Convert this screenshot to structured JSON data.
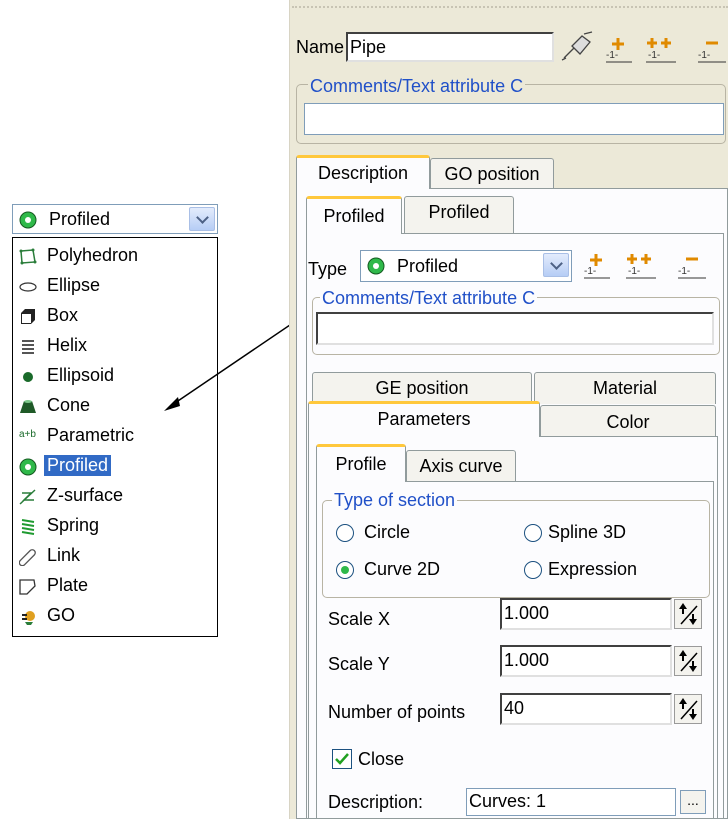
{
  "dropdown": {
    "selected": "Profiled",
    "items": [
      {
        "label": "Polyhedron",
        "icon": "polyhedron-icon"
      },
      {
        "label": "Ellipse",
        "icon": "ellipse-icon"
      },
      {
        "label": "Box",
        "icon": "box-icon"
      },
      {
        "label": "Helix",
        "icon": "helix-icon"
      },
      {
        "label": "Ellipsoid",
        "icon": "ellipsoid-icon"
      },
      {
        "label": "Cone",
        "icon": "cone-icon"
      },
      {
        "label": "Parametric",
        "icon": "parametric-icon",
        "glyph": "a+b"
      },
      {
        "label": "Profiled",
        "icon": "profiled-icon",
        "selected": true
      },
      {
        "label": "Z-surface",
        "icon": "z-surface-icon"
      },
      {
        "label": "Spring",
        "icon": "spring-icon"
      },
      {
        "label": "Link",
        "icon": "link-icon"
      },
      {
        "label": "Plate",
        "icon": "plate-icon"
      },
      {
        "label": "GO",
        "icon": "go-icon"
      }
    ]
  },
  "panel": {
    "name_label": "Name",
    "name_value": "Pipe",
    "comments_label": "Comments/Text attribute C",
    "comments_value": "",
    "tabs": [
      "Description",
      "GO position"
    ],
    "subtabs": [
      "Profiled",
      "Profiled"
    ],
    "type_label": "Type",
    "type_value": "Profiled",
    "type_comments_label": "Comments/Text attribute C",
    "type_comments_value": "",
    "geom_tabs": {
      "row1": [
        "GE position",
        "Material"
      ],
      "row2": [
        "Parameters",
        "Color"
      ]
    },
    "profile_tabs": [
      "Profile",
      "Axis curve"
    ],
    "section_group_label": "Type of section",
    "section_options": [
      {
        "label": "Circle",
        "checked": false
      },
      {
        "label": "Spline 3D",
        "checked": false
      },
      {
        "label": "Curve 2D",
        "checked": true
      },
      {
        "label": "Expression",
        "checked": false
      }
    ],
    "scale_x_label": "Scale X",
    "scale_x_value": "1.000",
    "scale_y_label": "Scale Y",
    "scale_y_value": "1.000",
    "points_label": "Number of points",
    "points_value": "40",
    "close_label": "Close",
    "close_checked": true,
    "description_label": "Description:",
    "description_value": "Curves: 1",
    "ellipsis": "..."
  },
  "colors": {
    "selection": "#316ac5",
    "panel_bg": "#ece9d8",
    "accent_blue": "#2050c8",
    "tab_highlight": "#ffc83c",
    "radio_dot": "#2fb94a",
    "profiled_icon": "#2fb94a"
  }
}
